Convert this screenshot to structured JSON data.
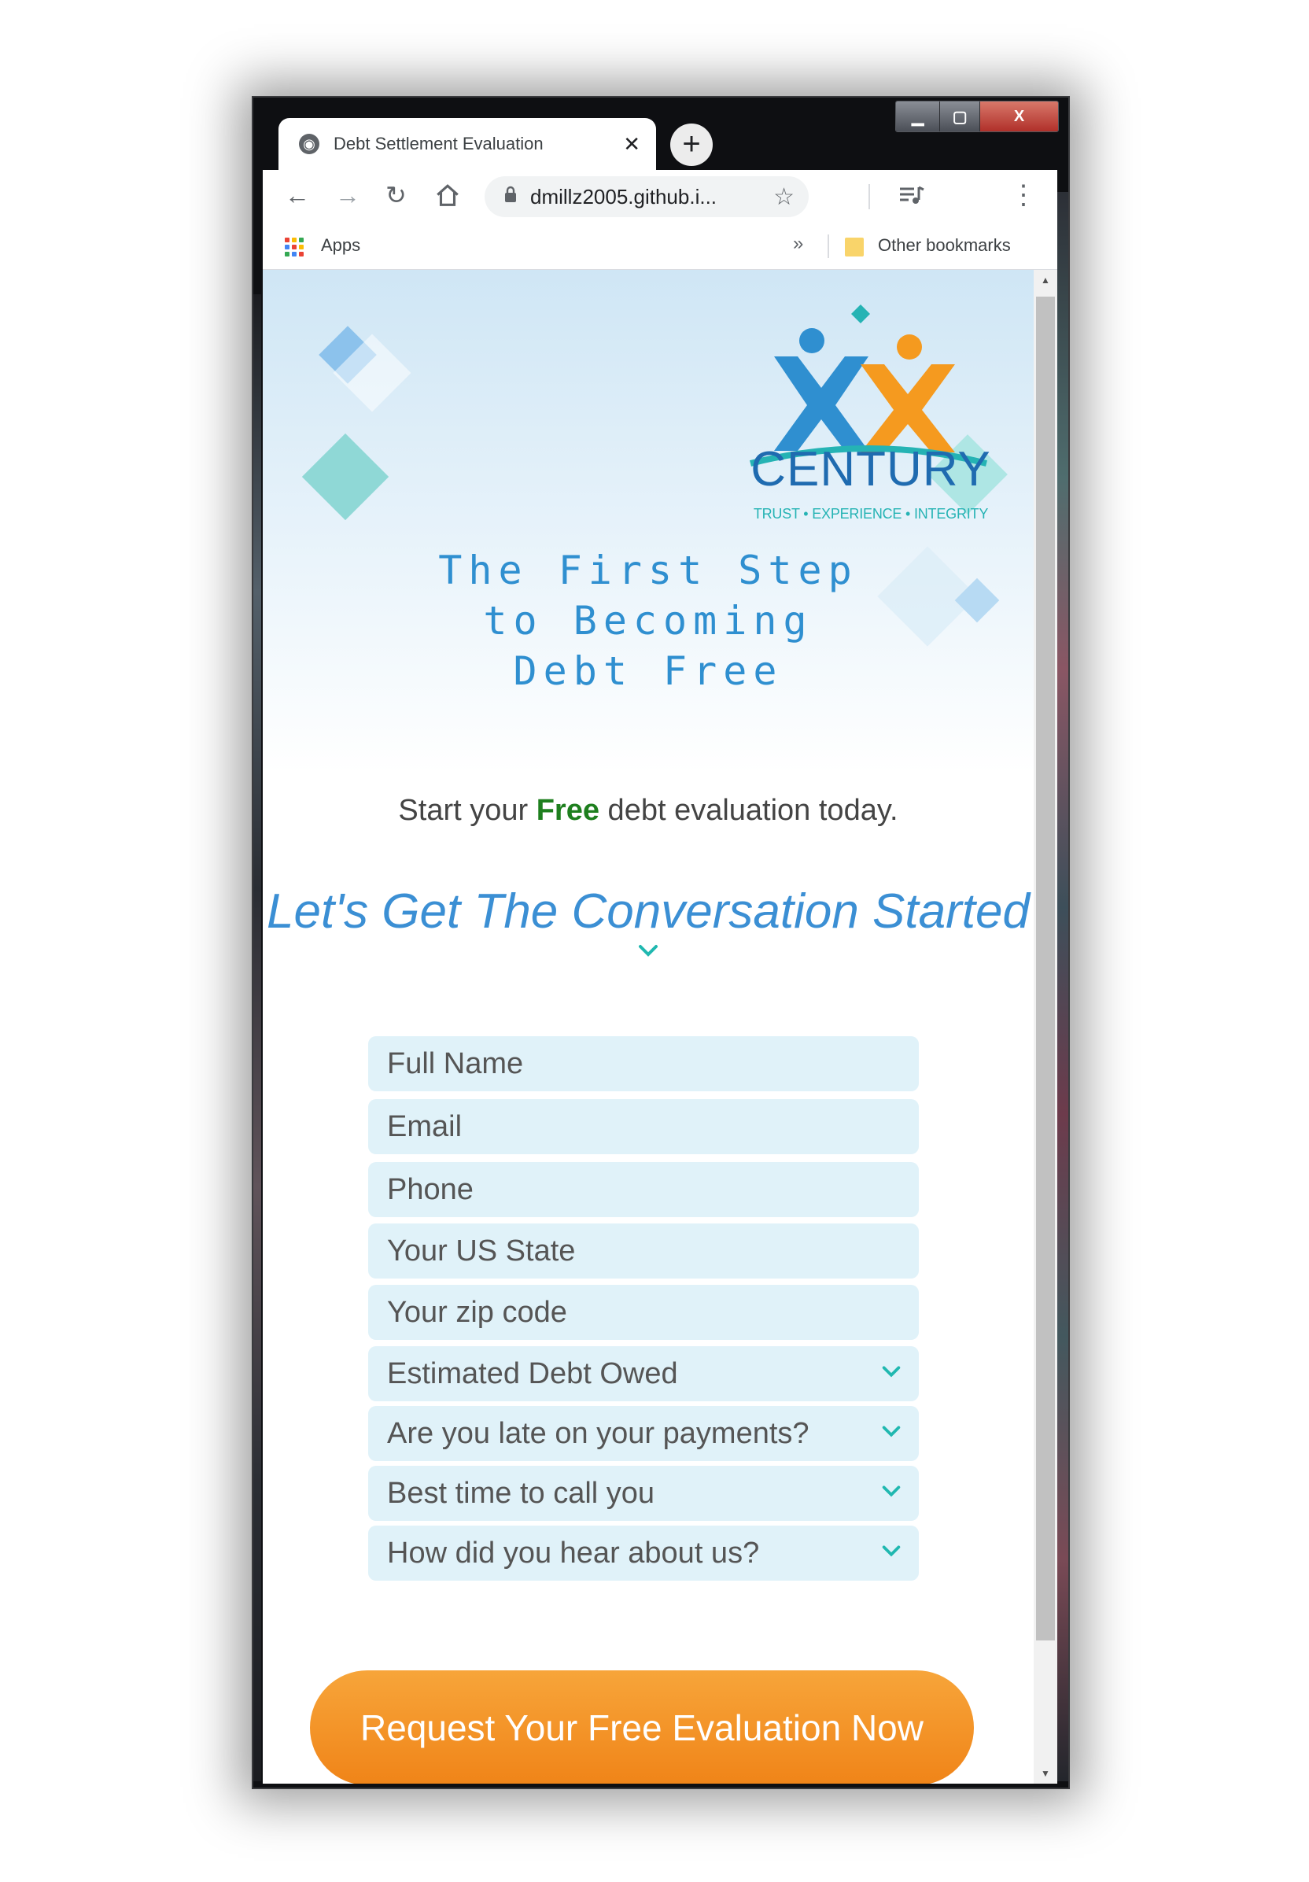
{
  "browser": {
    "tab_title": "Debt Settlement Evaluation",
    "new_tab_label": "+",
    "url": "dmillz2005.github.i...",
    "bookmarks": {
      "apps_label": "Apps",
      "more_label": "»",
      "other_label": "Other bookmarks"
    },
    "window_controls": {
      "minimize": "▁",
      "maximize": "▢",
      "close": "X"
    }
  },
  "logo": {
    "wordmark": "CENTURY",
    "tagline": "TRUST • EXPERIENCE • INTEGRITY",
    "colors": {
      "blue": "#2f8fd0",
      "orange": "#f59a1f",
      "teal": "#25b3b4"
    }
  },
  "hero": {
    "headline_lines": [
      "The First Step",
      "to Becoming",
      "Debt Free"
    ],
    "subtext_before": "Start your ",
    "subtext_highlight": "Free",
    "subtext_after": " debt evaluation today.",
    "conversation_title": "Let's Get The Conversation Started"
  },
  "form": {
    "inputs": [
      {
        "placeholder": "Full Name"
      },
      {
        "placeholder": "Email"
      },
      {
        "placeholder": "Phone"
      },
      {
        "placeholder": "Your US State"
      },
      {
        "placeholder": "Your zip code"
      }
    ],
    "selects": [
      {
        "value": "Estimated Debt Owed"
      },
      {
        "value": "Are you late on your payments?"
      },
      {
        "value": "Best time to call you"
      },
      {
        "value": "How did you hear about us?"
      }
    ],
    "submit_label": "Request Your Free Evaluation Now"
  },
  "colors": {
    "accent_orange": "#f08418",
    "accent_teal": "#20b8b0",
    "title_blue": "#3b8fd4",
    "field_bg": "#e0f2f9"
  }
}
